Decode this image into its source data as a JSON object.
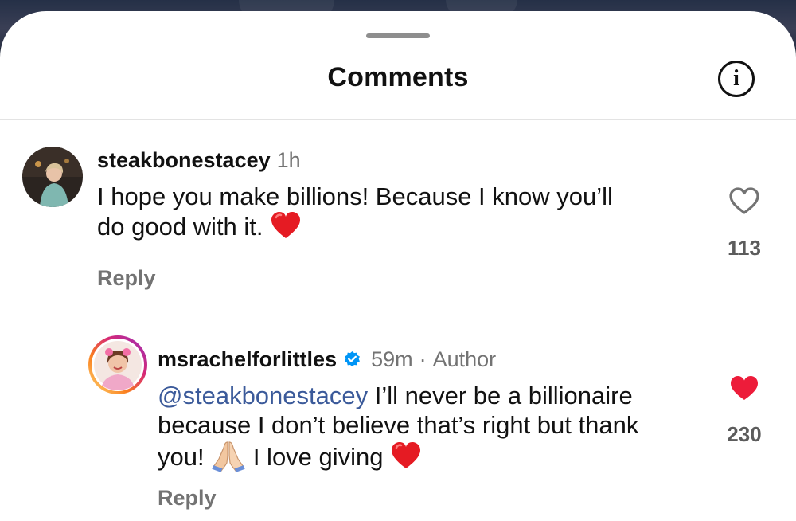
{
  "header": {
    "title": "Comments",
    "info_icon": "info-icon"
  },
  "comments": [
    {
      "username": "steakbonestacey",
      "time": "1h",
      "text_part1": "I hope you make billions! Because I know you’ll",
      "text_part2": "do good with it.",
      "emoji": "red-heart-emoji",
      "likes": "113",
      "liked": false,
      "reply_label": "Reply"
    },
    {
      "username": "msrachelforlittles",
      "verified": true,
      "time": "59m",
      "separator": "·",
      "author_tag": "Author",
      "mention": "@steakbonestacey",
      "text_part1": " I’ll never be a billionaire",
      "text_part2": "because I don’t believe that’s right but thank",
      "text_part3": "you! ",
      "text_part4": " I love giving ",
      "emojis": [
        "folded-hands-emoji",
        "red-heart-emoji"
      ],
      "likes": "230",
      "liked": true,
      "reply_label": "Reply"
    }
  ],
  "colors": {
    "like_active": "#ed1c3a",
    "mention": "#3b5a9a",
    "verified": "#0095f6"
  }
}
